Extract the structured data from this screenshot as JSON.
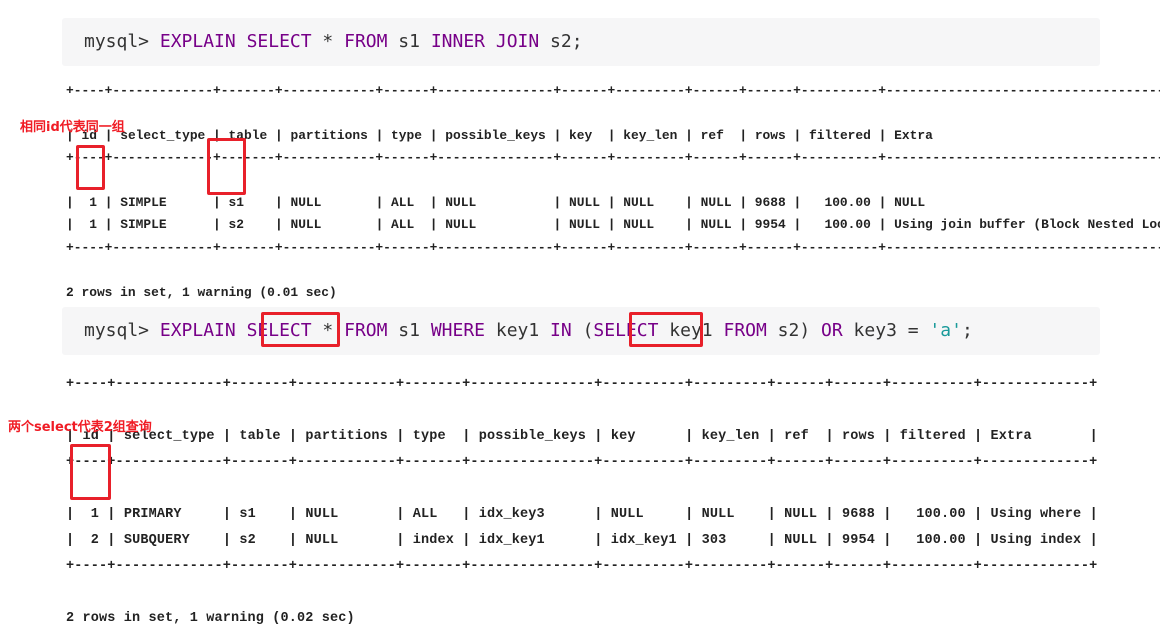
{
  "query1": {
    "tokens": [
      {
        "text": "mysql> ",
        "kind": "plain"
      },
      {
        "text": "EXPLAIN",
        "kind": "kw"
      },
      {
        "text": " ",
        "kind": "plain"
      },
      {
        "text": "SELECT",
        "kind": "kw"
      },
      {
        "text": " * ",
        "kind": "plain"
      },
      {
        "text": "FROM",
        "kind": "kw"
      },
      {
        "text": " s1 ",
        "kind": "plain"
      },
      {
        "text": "INNER",
        "kind": "kw"
      },
      {
        "text": " ",
        "kind": "plain"
      },
      {
        "text": "JOIN",
        "kind": "kw"
      },
      {
        "text": " s2;",
        "kind": "plain"
      }
    ]
  },
  "result1": {
    "columns": [
      "id",
      "select_type",
      "table",
      "partitions",
      "type",
      "possible_keys",
      "key",
      "key_len",
      "ref",
      "rows",
      "filtered",
      "Extra"
    ],
    "right_align": [
      "id",
      "rows",
      "filtered"
    ],
    "rows": [
      [
        "1",
        "SIMPLE",
        "s1",
        "NULL",
        "ALL",
        "NULL",
        "NULL",
        "NULL",
        "NULL",
        "9688",
        "100.00",
        "NULL"
      ],
      [
        "1",
        "SIMPLE",
        "s2",
        "NULL",
        "ALL",
        "NULL",
        "NULL",
        "NULL",
        "NULL",
        "9954",
        "100.00",
        "Using join buffer (Block Nested Loop)"
      ]
    ],
    "footer": "2 rows in set, 1 warning (0.01 sec)",
    "annotation": "相同id代表同一组"
  },
  "query2": {
    "tokens": [
      {
        "text": "mysql> ",
        "kind": "plain"
      },
      {
        "text": "EXPLAIN",
        "kind": "kw"
      },
      {
        "text": " ",
        "kind": "plain"
      },
      {
        "text": "SELECT",
        "kind": "kw"
      },
      {
        "text": " * ",
        "kind": "plain"
      },
      {
        "text": "FROM",
        "kind": "kw"
      },
      {
        "text": " s1 ",
        "kind": "plain"
      },
      {
        "text": "WHERE",
        "kind": "kw"
      },
      {
        "text": " key1 ",
        "kind": "plain"
      },
      {
        "text": "IN",
        "kind": "kw"
      },
      {
        "text": " (",
        "kind": "plain"
      },
      {
        "text": "SELECT",
        "kind": "kw"
      },
      {
        "text": " key1 ",
        "kind": "plain"
      },
      {
        "text": "FROM",
        "kind": "kw"
      },
      {
        "text": " s2) ",
        "kind": "plain"
      },
      {
        "text": "OR",
        "kind": "kw"
      },
      {
        "text": " key3 = ",
        "kind": "plain"
      },
      {
        "text": "'a'",
        "kind": "str"
      },
      {
        "text": ";",
        "kind": "plain"
      }
    ]
  },
  "result2": {
    "columns": [
      "id",
      "select_type",
      "table",
      "partitions",
      "type",
      "possible_keys",
      "key",
      "key_len",
      "ref",
      "rows",
      "filtered",
      "Extra"
    ],
    "right_align": [
      "id",
      "rows",
      "filtered"
    ],
    "rows": [
      [
        "1",
        "PRIMARY",
        "s1",
        "NULL",
        "ALL",
        "idx_key3",
        "NULL",
        "NULL",
        "NULL",
        "9688",
        "100.00",
        "Using where"
      ],
      [
        "2",
        "SUBQUERY",
        "s2",
        "NULL",
        "index",
        "idx_key1",
        "idx_key1",
        "303",
        "NULL",
        "9954",
        "100.00",
        "Using index"
      ]
    ],
    "footer": "2 rows in set, 1 warning (0.02 sec)",
    "annotation": "两个select代表2组查询"
  },
  "colors": {
    "keyword": "#770088",
    "string": "#1a9a9a",
    "highlight_box": "#e8202a",
    "code_bg": "#f6f6f7"
  }
}
